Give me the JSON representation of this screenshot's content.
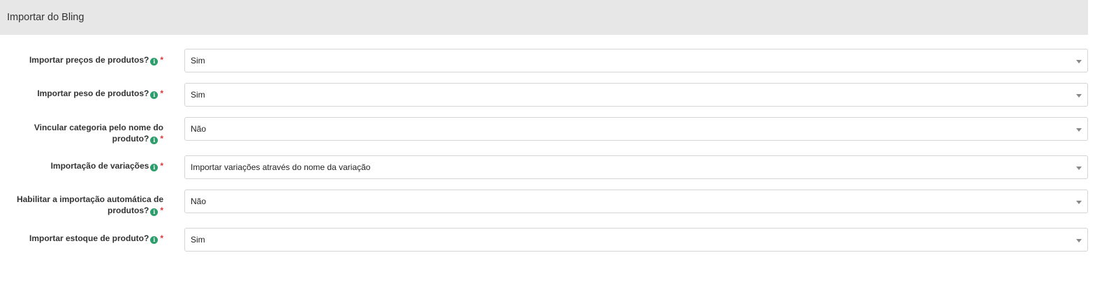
{
  "header": {
    "title": "Importar do Bling"
  },
  "fields": [
    {
      "label": "Importar preços de produtos?",
      "value": "Sim"
    },
    {
      "label": "Importar peso de produtos?",
      "value": "Sim"
    },
    {
      "label": "Vincular categoria pelo nome do produto?",
      "value": "Não"
    },
    {
      "label": "Importação de variações",
      "value": "Importar variações através do nome da variação"
    },
    {
      "label": "Habilitar a importação automática de produtos?",
      "value": "Não"
    },
    {
      "label": "Importar estoque de produto?",
      "value": "Sim"
    }
  ],
  "required_marker": "*",
  "info_icon": "info-icon",
  "colors": {
    "header_bg": "#e7e7e7",
    "info_icon": "#2c9d6b",
    "required": "#e0393e"
  }
}
